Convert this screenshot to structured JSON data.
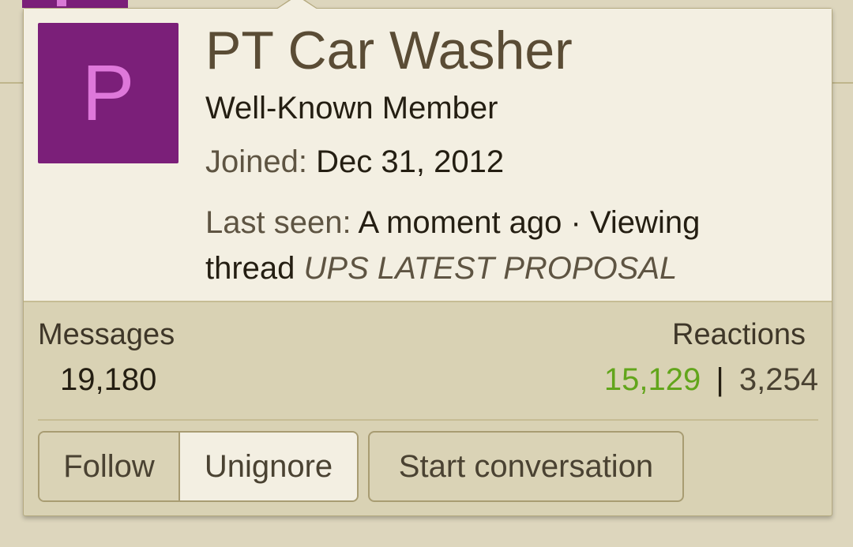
{
  "profile": {
    "avatar_letter": "P",
    "username": "PT Car Washer",
    "user_title": "Well-Known Member",
    "joined_label": "Joined:",
    "joined_date": "Dec 31, 2012",
    "last_seen_label": "Last seen:",
    "last_seen_value": "A moment ago · Viewing thread",
    "thread_title": "UPS LATEST PROPOSAL"
  },
  "stats": {
    "messages_label": "Messages",
    "messages_value": "19,180",
    "reactions_label": "Reactions",
    "reactions_positive": "15,129",
    "reactions_separator": "|",
    "reactions_negative": "3,254"
  },
  "actions": {
    "follow_label": "Follow",
    "unignore_label": "Unignore",
    "start_conversation_label": "Start conversation"
  },
  "colors": {
    "avatar_bg": "#7b1f79",
    "avatar_letter": "#de78da",
    "positive_reactions": "#62a51b"
  }
}
